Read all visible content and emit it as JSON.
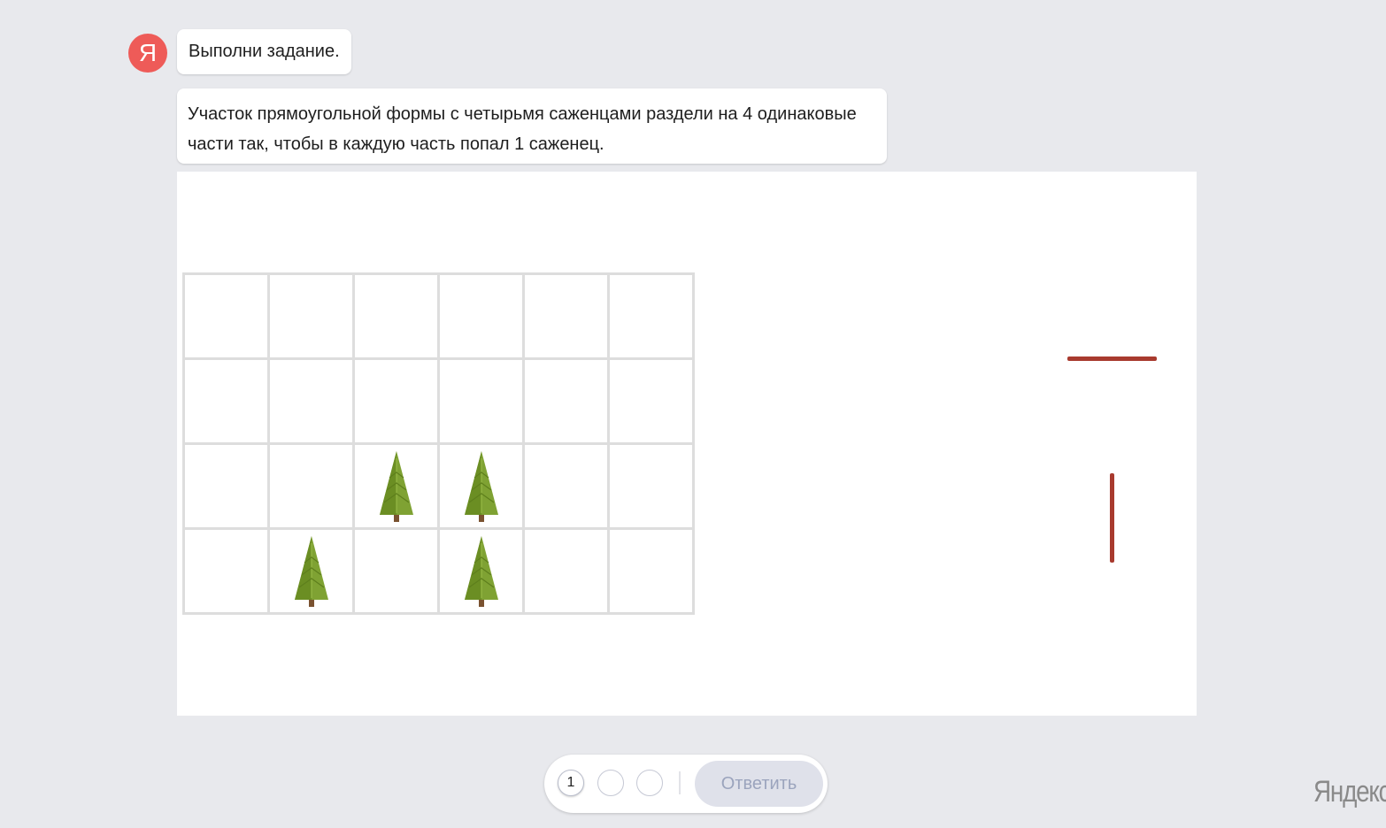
{
  "assistant": {
    "avatar_letter": "Я",
    "avatar_color": "#ee5b58",
    "title": "Выполни задание.",
    "task_text": "Участок прямоугольной формы с четырьмя саженцами раздели на 4 одинаковые части так, чтобы в каждую часть попал 1 саженец."
  },
  "board": {
    "grid_rows": 4,
    "grid_cols": 6,
    "trees": [
      {
        "row": 3,
        "col": 3
      },
      {
        "row": 3,
        "col": 4
      },
      {
        "row": 4,
        "col": 2
      },
      {
        "row": 4,
        "col": 4
      }
    ],
    "tree_icon": "fir-tree-icon",
    "stick_color": "#a83a2e",
    "sticks": [
      {
        "orientation": "horizontal"
      },
      {
        "orientation": "vertical"
      }
    ]
  },
  "controls": {
    "steps": [
      {
        "label": "1",
        "active": true
      },
      {
        "label": "",
        "active": false
      },
      {
        "label": "",
        "active": false
      }
    ],
    "answer_label": "Ответить"
  },
  "logo": "Яндекс"
}
